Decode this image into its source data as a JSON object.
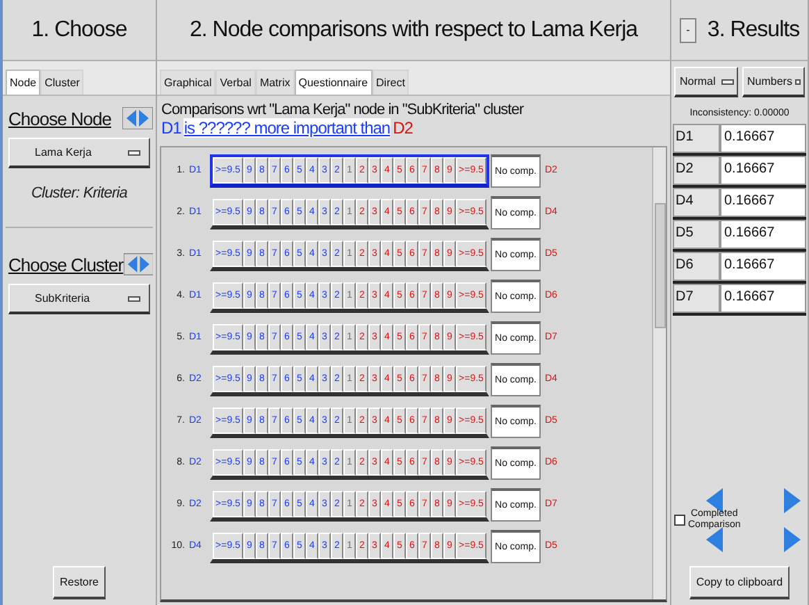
{
  "left_panel": {
    "title": "1. Choose",
    "tabs": [
      {
        "label": "Node",
        "selected": true
      },
      {
        "label": "Cluster",
        "selected": false
      }
    ],
    "choose_node": {
      "label": "Choose Node",
      "value": "Lama Kerja"
    },
    "cluster_label": "Cluster: Kriteria",
    "choose_cluster": {
      "label": "Choose Cluster",
      "value": "SubKriteria"
    },
    "restore_button": "Restore"
  },
  "middle_panel": {
    "title": "2. Node comparisons with respect to Lama Kerja",
    "tabs": [
      {
        "label": "Graphical",
        "selected": false
      },
      {
        "label": "Verbal",
        "selected": false
      },
      {
        "label": "Matrix",
        "selected": false
      },
      {
        "label": "Questionnaire",
        "selected": true
      },
      {
        "label": "Direct",
        "selected": false
      }
    ],
    "heading": "Comparisons wrt \"Lama Kerja\" node in \"SubKriteria\" cluster",
    "question": {
      "left": "D1",
      "link": "is ?????? more important than",
      "right": "D2"
    },
    "rows": [
      {
        "number": "1.",
        "left": "D1",
        "right": "D2",
        "selected": true,
        "scale": [
          ">=9.5",
          "9",
          "8",
          "7",
          "6",
          "5",
          "4",
          "3",
          "2",
          "1",
          "2",
          "3",
          "4",
          "5",
          "6",
          "7",
          "8",
          "9",
          ">=9.5"
        ],
        "no_comp": "No comp."
      },
      {
        "number": "2.",
        "left": "D1",
        "right": "D4",
        "selected": false,
        "scale": [
          ">=9.5",
          "9",
          "8",
          "7",
          "6",
          "5",
          "4",
          "3",
          "2",
          "1",
          "2",
          "3",
          "4",
          "5",
          "6",
          "7",
          "8",
          "9",
          ">=9.5"
        ],
        "no_comp": "No comp."
      },
      {
        "number": "3.",
        "left": "D1",
        "right": "D5",
        "selected": false,
        "scale": [
          ">=9.5",
          "9",
          "8",
          "7",
          "6",
          "5",
          "4",
          "3",
          "2",
          "1",
          "2",
          "3",
          "4",
          "5",
          "6",
          "7",
          "8",
          "9",
          ">=9.5"
        ],
        "no_comp": "No comp."
      },
      {
        "number": "4.",
        "left": "D1",
        "right": "D6",
        "selected": false,
        "scale": [
          ">=9.5",
          "9",
          "8",
          "7",
          "6",
          "5",
          "4",
          "3",
          "2",
          "1",
          "2",
          "3",
          "4",
          "5",
          "6",
          "7",
          "8",
          "9",
          ">=9.5"
        ],
        "no_comp": "No comp."
      },
      {
        "number": "5.",
        "left": "D1",
        "right": "D7",
        "selected": false,
        "scale": [
          ">=9.5",
          "9",
          "8",
          "7",
          "6",
          "5",
          "4",
          "3",
          "2",
          "1",
          "2",
          "3",
          "4",
          "5",
          "6",
          "7",
          "8",
          "9",
          ">=9.5"
        ],
        "no_comp": "No comp."
      },
      {
        "number": "6.",
        "left": "D2",
        "right": "D4",
        "selected": false,
        "scale": [
          ">=9.5",
          "9",
          "8",
          "7",
          "6",
          "5",
          "4",
          "3",
          "2",
          "1",
          "2",
          "3",
          "4",
          "5",
          "6",
          "7",
          "8",
          "9",
          ">=9.5"
        ],
        "no_comp": "No comp."
      },
      {
        "number": "7.",
        "left": "D2",
        "right": "D5",
        "selected": false,
        "scale": [
          ">=9.5",
          "9",
          "8",
          "7",
          "6",
          "5",
          "4",
          "3",
          "2",
          "1",
          "2",
          "3",
          "4",
          "5",
          "6",
          "7",
          "8",
          "9",
          ">=9.5"
        ],
        "no_comp": "No comp."
      },
      {
        "number": "8.",
        "left": "D2",
        "right": "D6",
        "selected": false,
        "scale": [
          ">=9.5",
          "9",
          "8",
          "7",
          "6",
          "5",
          "4",
          "3",
          "2",
          "1",
          "2",
          "3",
          "4",
          "5",
          "6",
          "7",
          "8",
          "9",
          ">=9.5"
        ],
        "no_comp": "No comp."
      },
      {
        "number": "9.",
        "left": "D2",
        "right": "D7",
        "selected": false,
        "scale": [
          ">=9.5",
          "9",
          "8",
          "7",
          "6",
          "5",
          "4",
          "3",
          "2",
          "1",
          "2",
          "3",
          "4",
          "5",
          "6",
          "7",
          "8",
          "9",
          ">=9.5"
        ],
        "no_comp": "No comp."
      },
      {
        "number": "10.",
        "left": "D4",
        "right": "D5",
        "selected": false,
        "scale": [
          ">=9.5",
          "9",
          "8",
          "7",
          "6",
          "5",
          "4",
          "3",
          "2",
          "1",
          "2",
          "3",
          "4",
          "5",
          "6",
          "7",
          "8",
          "9",
          ">=9.5"
        ],
        "no_comp": "No comp."
      }
    ]
  },
  "right_panel": {
    "collapse_button": "-",
    "title": "3. Results",
    "dropdowns": [
      "Normal",
      "Numbers"
    ],
    "inconsistency": "Inconsistency: 0.00000",
    "results": [
      {
        "name": "D1",
        "value": "0.16667"
      },
      {
        "name": "D2",
        "value": "0.16667"
      },
      {
        "name": "D4",
        "value": "0.16667"
      },
      {
        "name": "D5",
        "value": "0.16667"
      },
      {
        "name": "D6",
        "value": "0.16667"
      },
      {
        "name": "D7",
        "value": "0.16667"
      }
    ],
    "completed": {
      "label": "Completed Comparison",
      "checked": false
    },
    "copy_button": "Copy to clipboard"
  }
}
